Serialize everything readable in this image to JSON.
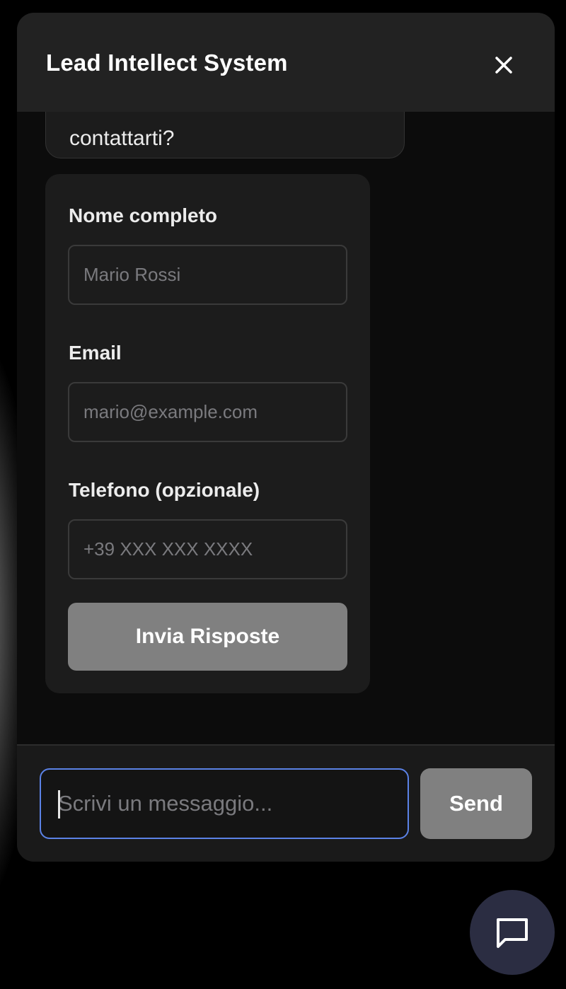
{
  "header": {
    "title": "Lead Intellect System",
    "close_icon": "close-icon"
  },
  "messages": {
    "bot_bubble_text": "contattarti?"
  },
  "form": {
    "name_label": "Nome completo",
    "name_placeholder": "Mario Rossi",
    "email_label": "Email",
    "email_placeholder": "mario@example.com",
    "phone_label": "Telefono (opzionale)",
    "phone_placeholder": "+39 XXX XXX XXXX",
    "submit_label": "Invia Risposte"
  },
  "composer": {
    "placeholder": "Scrivi un messaggio...",
    "send_label": "Send"
  },
  "launcher": {
    "icon": "chat-bubble-icon"
  },
  "colors": {
    "header_bg": "#222222",
    "panel_bg": "#0c0c0c",
    "card_bg": "#1c1c1c",
    "button_gray": "#808080",
    "focus_blue": "#5b82e6",
    "launcher_bg": "#2b2d42"
  }
}
